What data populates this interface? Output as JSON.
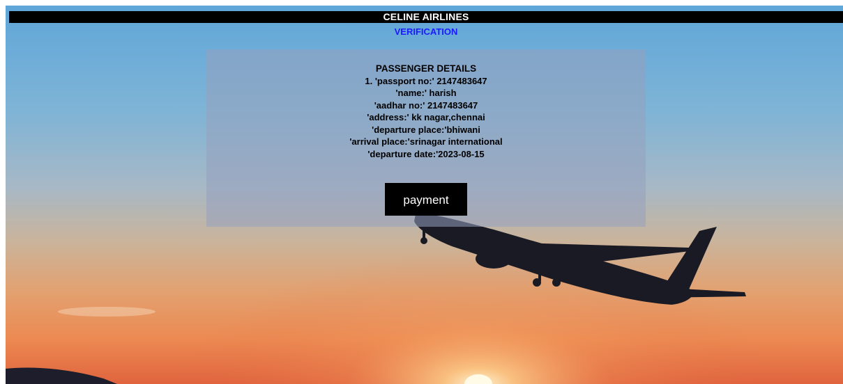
{
  "header": {
    "title": "CELINE AIRLINES",
    "subtitle": "VERIFICATION"
  },
  "passenger_details": {
    "heading": "PASSENGER DETAILS",
    "lines": [
      "1. 'passport no:' 2147483647",
      "'name:' harish",
      "'aadhar no:' 2147483647",
      "'address:' kk nagar,chennai",
      "'departure place:'bhiwani",
      "'arrival place:'srinagar international",
      "'departure date:'2023-08-15"
    ]
  },
  "actions": {
    "payment_label": "payment"
  },
  "colors": {
    "title_bar_bg": "#000000",
    "subtitle_text": "#1a1aff",
    "button_bg": "#000000"
  },
  "background": {
    "icon": "airplane-sunset-image"
  }
}
